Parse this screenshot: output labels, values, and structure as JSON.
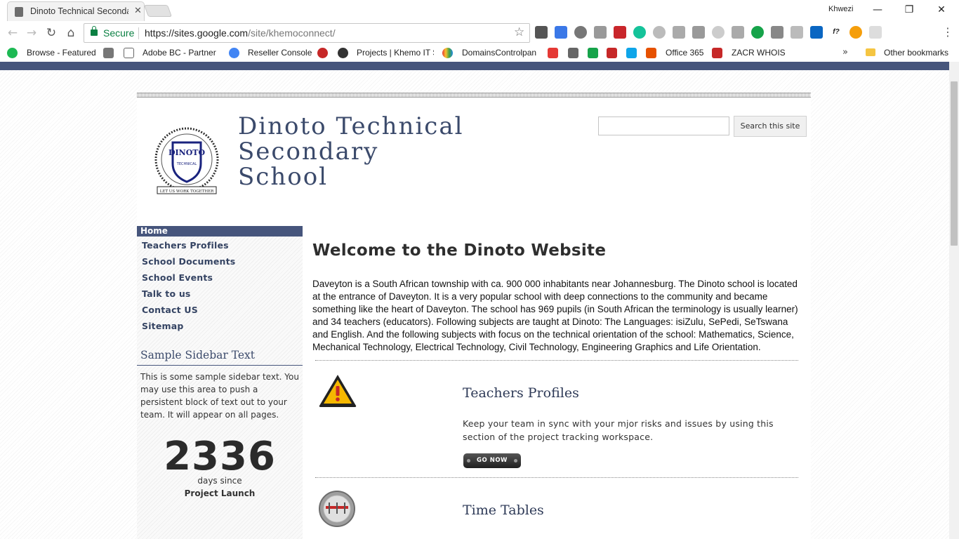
{
  "browser": {
    "tab_title": "Dinoto Technical Secondary School",
    "profile_name": "Khwezi",
    "secure_label": "Secure",
    "url_host": "https://sites.google.com",
    "url_path": "/site/khemoconnect/",
    "bookmarks": [
      "Browse - Featured",
      "Adobe BC - Partner P",
      "Reseller Console",
      "Projects | Khemo IT S",
      "DomainsControlpan",
      "Office 365",
      "ZACR WHOIS"
    ],
    "other_bookmarks": "Other bookmarks",
    "colors": {
      "secure": "#0b8043",
      "site_accent": "#46557c"
    }
  },
  "site": {
    "title": "Dinoto Technical\nSecondary\nSchool",
    "search_button": "Search this site",
    "logo_text_top": "DINOTO",
    "logo_text_mid": "TECHNICAL",
    "logo_motto": "LET US WORK TOGETHER"
  },
  "sidebar": {
    "home": "Home",
    "items": [
      "Teachers Profiles",
      "School Documents",
      "School Events",
      "Talk to us",
      "Contact US",
      "Sitemap"
    ],
    "heading": "Sample Sidebar Text",
    "text": "This is some sample sidebar text. You may use this area to push a persistent block of text out to your team. It will appear on all pages.",
    "counter": "2336",
    "counter_sub": "days since",
    "counter_label": "Project Launch"
  },
  "main": {
    "heading": "Welcome to the Dinoto Website",
    "paragraph": "Daveyton is a South African township with ca. 900 000 inhabitants near Johannesburg. The Dinoto school is located at the entrance of Daveyton. It is a very popular school with deep connections to the community and became something like the heart of Daveyton. The school has 969 pupils (in South African the terminology is usually learner) and 34 teachers (educators). Following subjects are taught at Dinoto: The Languages: isiZulu, SePedi, SeTswana and English. And the following subjects with focus on the technical orientation of the school: Mathematics, Science, Mechanical Technology, Electrical Technology, Civil Technology, Engineering Graphics and Life Orientation.",
    "sections": [
      {
        "title": "Teachers Profiles",
        "desc": "Keep your team in sync with your mjor risks and issues by using this section of the project tracking workspace.",
        "button": "GO NOW"
      },
      {
        "title": "Time Tables"
      }
    ]
  }
}
